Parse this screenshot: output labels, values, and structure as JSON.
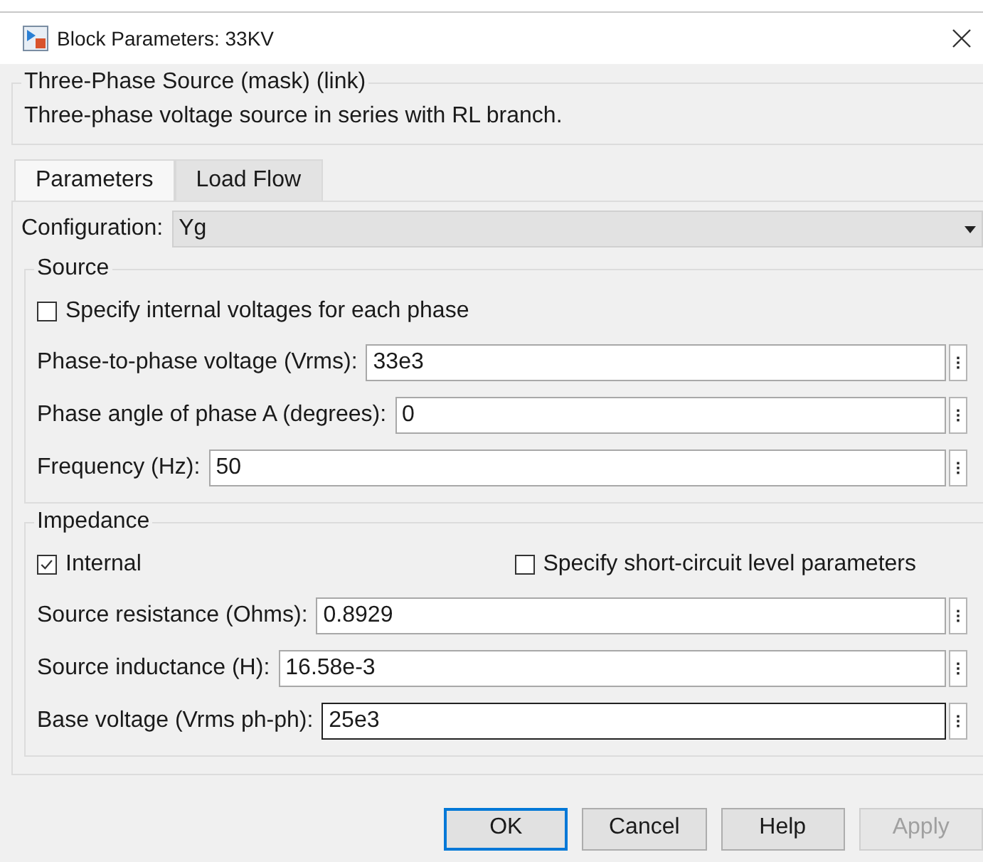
{
  "window": {
    "title": "Block Parameters: 33KV"
  },
  "mask": {
    "title": "Three-Phase Source (mask) (link)",
    "description": "Three-phase voltage source in series with RL branch."
  },
  "tabs": [
    {
      "label": "Parameters",
      "selected": true
    },
    {
      "label": "Load Flow",
      "selected": false
    }
  ],
  "configuration": {
    "label": "Configuration:",
    "value": "Yg"
  },
  "groups": [
    {
      "title": "Source",
      "rows": [
        {
          "kind": "checkboxes",
          "items": [
            {
              "label": "Specify internal voltages for each phase",
              "checked": false
            }
          ]
        },
        {
          "kind": "field",
          "label": "Phase-to-phase voltage (Vrms):",
          "value": "33e3",
          "focused": false
        },
        {
          "kind": "field",
          "label": "Phase angle of phase A (degrees):",
          "value": "0",
          "focused": false
        },
        {
          "kind": "field",
          "label": "Frequency (Hz):",
          "value": "50",
          "focused": false
        }
      ]
    },
    {
      "title": "Impedance",
      "rows": [
        {
          "kind": "checkboxes",
          "items": [
            {
              "label": "Internal",
              "checked": true
            },
            {
              "label": "Specify short-circuit level parameters",
              "checked": false
            }
          ]
        },
        {
          "kind": "field",
          "label": "Source resistance (Ohms):",
          "value": "0.8929",
          "focused": false
        },
        {
          "kind": "field",
          "label": "Source inductance (H):",
          "value": "16.58e-3",
          "focused": false
        },
        {
          "kind": "field",
          "label": "Base voltage (Vrms ph-ph):",
          "value": "25e3",
          "focused": true
        }
      ]
    }
  ],
  "buttons": [
    {
      "label": "OK",
      "default": true,
      "disabled": false
    },
    {
      "label": "Cancel",
      "default": false,
      "disabled": false
    },
    {
      "label": "Help",
      "default": false,
      "disabled": false
    },
    {
      "label": "Apply",
      "default": false,
      "disabled": true
    }
  ]
}
